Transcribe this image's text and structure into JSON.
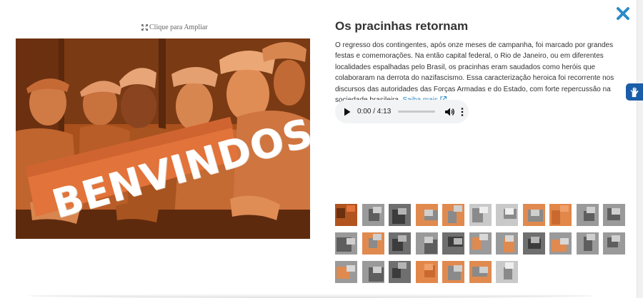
{
  "modal": {
    "enlarge_label": "Clique para Ampliar",
    "photo_banner_text": "BENVINDOS",
    "title": "Os pracinhas retornam",
    "description": "O regresso dos contingentes, após onze meses de campanha, foi marcado por grandes festas e comemorações. Na então capital federal, o Rio de Janeiro, ou em diferentes localidades espalhadas pelo Brasil, os pracinhas eram saudados como heróis que colaboraram na derrota do nazifascismo. Essa caracterização heroica foi recorrente nos discursos das autoridades das Forças Armadas e do Estado, com forte repercussão na sociedade brasileira.",
    "more_link": "Saiba mais",
    "close_icon": "close-x-icon"
  },
  "audio": {
    "time_display": "0:00 / 4:13",
    "progress": 0
  },
  "thumbnails": [
    {
      "tone": "orange-dark"
    },
    {
      "tone": "gray"
    },
    {
      "tone": "gray-dark"
    },
    {
      "tone": "orange-gray"
    },
    {
      "tone": "orange-gray"
    },
    {
      "tone": "gray-light"
    },
    {
      "tone": "gray-light"
    },
    {
      "tone": "orange-gray"
    },
    {
      "tone": "orange"
    },
    {
      "tone": "gray"
    },
    {
      "tone": "gray"
    },
    {
      "tone": "gray"
    },
    {
      "tone": "orange-gray"
    },
    {
      "tone": "gray-dark"
    },
    {
      "tone": "gray"
    },
    {
      "tone": "gray-dark"
    },
    {
      "tone": "gray-orange"
    },
    {
      "tone": "gray-orange"
    },
    {
      "tone": "gray-dark"
    },
    {
      "tone": "gray-orange"
    },
    {
      "tone": "gray"
    },
    {
      "tone": "gray"
    },
    {
      "tone": "gray-orange"
    },
    {
      "tone": "gray"
    },
    {
      "tone": "gray-dark"
    },
    {
      "tone": "orange"
    },
    {
      "tone": "orange-gray"
    },
    {
      "tone": "orange-gray"
    },
    {
      "tone": "gray-light"
    }
  ],
  "colors": {
    "accent": "#2c8bc7",
    "photo_orange": "#b1541f",
    "accessibility_button": "#1a5da8"
  },
  "icons": {
    "enlarge": "expand-icon",
    "external_link": "external-link-icon",
    "accessibility": "hand-sign-language-icon"
  }
}
